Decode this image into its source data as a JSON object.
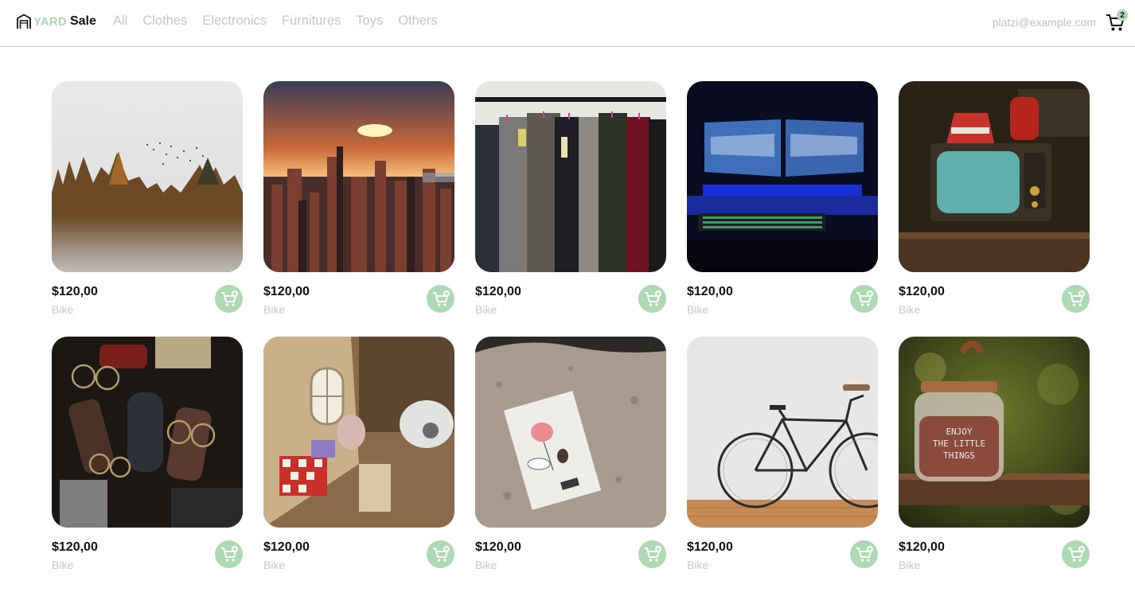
{
  "brand": {
    "yard": "YARD",
    "sale": "Sale",
    "accent": "#acd9b2"
  },
  "nav": {
    "categories": [
      "All",
      "Clothes",
      "Electronics",
      "Furnitures",
      "Toys",
      "Others"
    ],
    "email": "platzi@example.com",
    "cart_count": "2",
    "cart_icon": "shopping-cart-icon"
  },
  "products": [
    {
      "price": "$120,00",
      "name": "Bike",
      "image": "misty-forest-with-birds"
    },
    {
      "price": "$120,00",
      "name": "Bike",
      "image": "city-skyline-at-sunset"
    },
    {
      "price": "$120,00",
      "name": "Bike",
      "image": "coats-on-clothing-rack"
    },
    {
      "price": "$120,00",
      "name": "Bike",
      "image": "dual-monitor-gaming-setup"
    },
    {
      "price": "$120,00",
      "name": "Bike",
      "image": "vintage-tv-with-iron"
    },
    {
      "price": "$120,00",
      "name": "Bike",
      "image": "pile-of-glasses-and-cases"
    },
    {
      "price": "$120,00",
      "name": "Bike",
      "image": "box-of-toys-and-lamp"
    },
    {
      "price": "$120,00",
      "name": "Bike",
      "image": "enamel-pins-on-stone"
    },
    {
      "price": "$120,00",
      "name": "Bike",
      "image": "bicycle-against-white-wall"
    },
    {
      "price": "$120,00",
      "name": "Bike",
      "image": "candle-jar-enjoy-the-little-things",
      "jar_text": [
        "ENJOY",
        "THE LITTLE",
        "THINGS"
      ]
    }
  ],
  "add_to_cart_icon": "add-to-cart-icon"
}
